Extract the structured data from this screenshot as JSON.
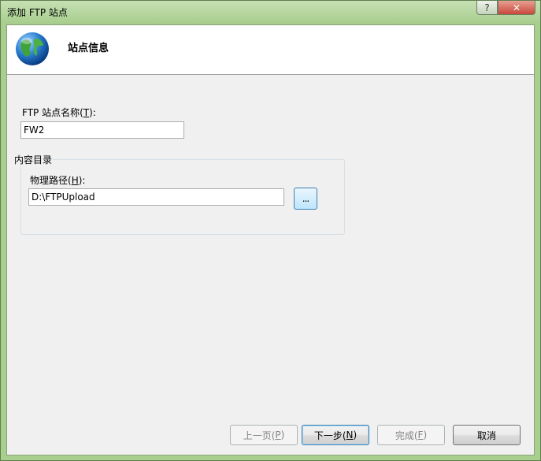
{
  "window": {
    "title": "添加 FTP 站点",
    "help_label": "?",
    "close_label": "✕"
  },
  "header": {
    "title": "站点信息",
    "icon": "globe-icon"
  },
  "form": {
    "site_name_label": "FTP 站点名称(",
    "site_name_accel": "T",
    "site_name_label_end": "):",
    "site_name_value": "FW2",
    "content_dir_title": "内容目录",
    "physical_path_label": "物理路径(",
    "physical_path_accel": "H",
    "physical_path_label_end": "):",
    "physical_path_value": "D:\\FTPUpload",
    "browse_label": "..."
  },
  "buttons": {
    "prev_label": "上一页(",
    "prev_accel": "P",
    "next_label": "下一步(",
    "next_accel": "N",
    "finish_label": "完成(",
    "finish_accel": "F",
    "close_paren": ")",
    "cancel_label": "取消"
  }
}
